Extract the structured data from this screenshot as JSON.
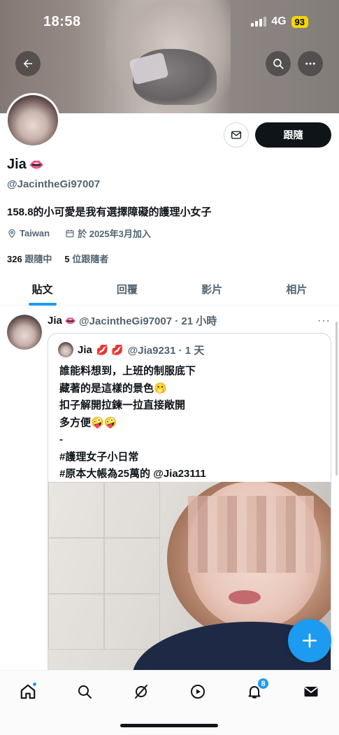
{
  "status_bar": {
    "time": "18:58",
    "network": "4G",
    "battery": "93"
  },
  "profile": {
    "display_name": "Jia",
    "name_emoji": "👄",
    "handle": "@JacintheGi97007",
    "bio": "158.8的小可愛是我有選擇障礙的護理小女子",
    "location": "Taiwan",
    "joined": "於 2025年3月加入",
    "following_count": "326",
    "following_label": "跟隨中",
    "followers_count": "5",
    "followers_label": "位跟隨者",
    "follow_button": "跟隨"
  },
  "tabs": [
    {
      "label": "貼文",
      "active": true
    },
    {
      "label": "回覆",
      "active": false
    },
    {
      "label": "影片",
      "active": false
    },
    {
      "label": "相片",
      "active": false
    }
  ],
  "post": {
    "author": "Jia",
    "author_emoji": "👄",
    "handle_time": "@JacintheGi97007 · 21 小時",
    "more": "···",
    "quote": {
      "author": "Jia",
      "author_emoji": "💋 💋",
      "handle_time": "@Jia9231 · 1 天",
      "text": "誰能料想到，上班的制服底下\n藏著的是這樣的景色🫢\n扣子解開拉鍊一拉直接敞開\n多方便🤪🤪\n-\n#護理女子小日常\n#原本大帳為25萬的 @Jia23111"
    }
  },
  "notifications_badge": "8",
  "colors": {
    "accent": "#1d9bf0",
    "text": "#0f1419",
    "secondary": "#536471"
  },
  "icons": [
    "back-arrow-icon",
    "search-icon",
    "more-icon",
    "mail-icon",
    "location-icon",
    "calendar-icon",
    "plus-icon",
    "home-icon",
    "explore-icon",
    "grok-icon",
    "video-icon",
    "bell-icon",
    "messages-icon"
  ]
}
